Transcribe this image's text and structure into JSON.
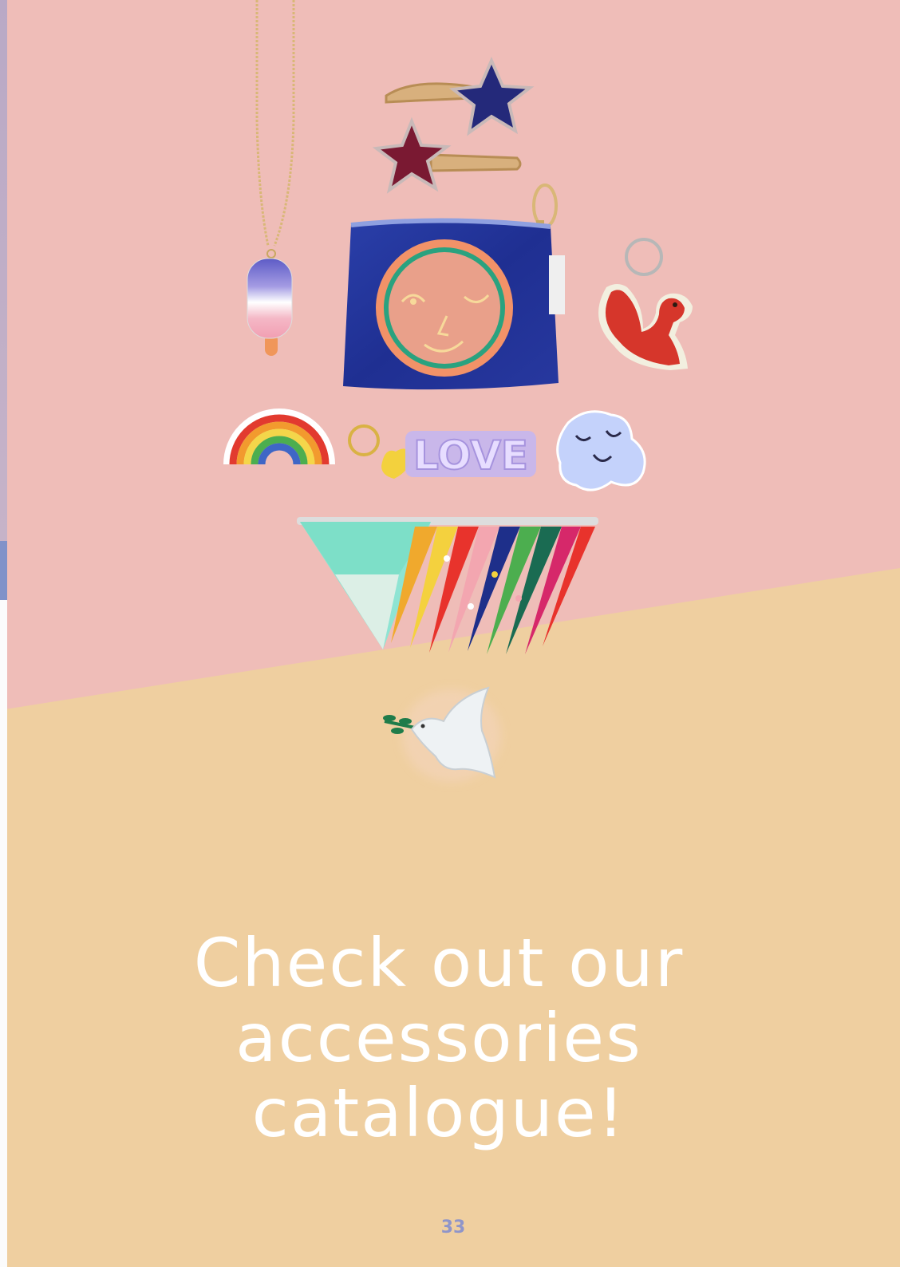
{
  "colors": {
    "pink_background": "#efbdb8",
    "yellow_background": "#efcfa0",
    "headline_text": "#ffffff",
    "page_number_text": "#8f95c9",
    "spine_accent": "#8092c9"
  },
  "headline": {
    "line1": "Check out our",
    "line2": "accessories",
    "line3": "catalogue!"
  },
  "products": {
    "keychain_text": "LOVE"
  },
  "page_number": "33"
}
